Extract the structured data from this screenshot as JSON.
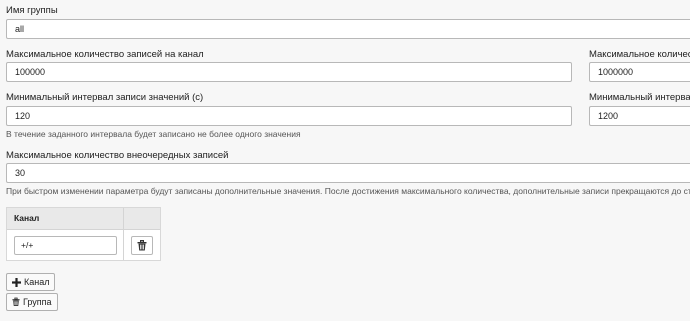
{
  "group": {
    "name_label": "Имя группы",
    "name_value": "all"
  },
  "fields": {
    "max_records_per_channel_label": "Максимальное количество записей на канал",
    "max_records_per_channel_value": "100000",
    "max_records_right_label": "Максимальное количество",
    "max_records_right_value": "1000000",
    "min_interval_label": "Минимальный интервал записи значений (с)",
    "min_interval_value": "120",
    "min_interval_right_label": "Минимальный интервал за",
    "min_interval_right_value": "1200",
    "min_interval_help": "В течение заданного интервала будет записано не более одного значения",
    "max_extra_label": "Максимальное количество внеочередных записей",
    "max_extra_value": "30",
    "max_extra_help": "При быстром изменении параметра будут записаны дополнительные значения. После достижения максимального количества, дополнительные записи прекращаются до стабилиз"
  },
  "channels_table": {
    "header": "Канал",
    "rows": [
      {
        "channel": "+/+"
      }
    ]
  },
  "actions": {
    "add_channel_label": "Канал",
    "delete_group_label": "Группа"
  },
  "icons": {
    "add": "plus-icon",
    "delete": "trash-icon"
  }
}
